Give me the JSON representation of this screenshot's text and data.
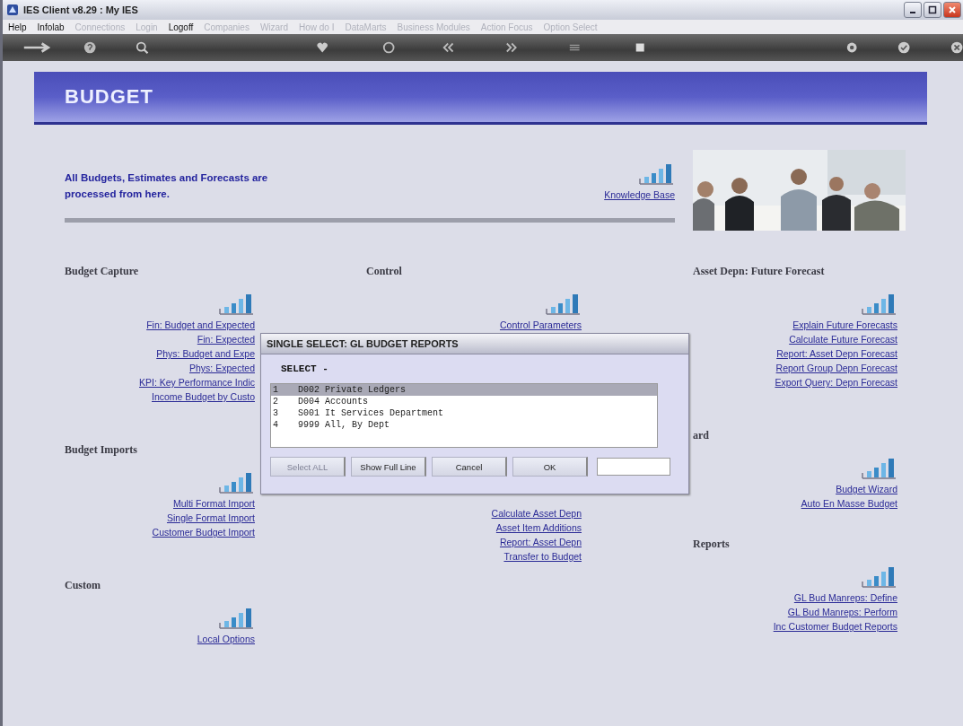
{
  "window": {
    "title": "IES Client v8.29 : My IES"
  },
  "menu": [
    {
      "label": "Help",
      "disabled": false
    },
    {
      "label": "Infolab",
      "disabled": false
    },
    {
      "label": "Connections",
      "disabled": true
    },
    {
      "label": "Login",
      "disabled": true
    },
    {
      "label": "Logoff",
      "disabled": false
    },
    {
      "label": "Companies",
      "disabled": true
    },
    {
      "label": "Wizard",
      "disabled": true
    },
    {
      "label": "How do I",
      "disabled": true
    },
    {
      "label": "DataMarts",
      "disabled": true
    },
    {
      "label": "Business Modules",
      "disabled": true
    },
    {
      "label": "Action Focus",
      "disabled": true
    },
    {
      "label": "Option Select",
      "disabled": true
    }
  ],
  "toolbar": [
    {
      "kind": "arrow"
    },
    {
      "kind": "help"
    },
    {
      "kind": "search"
    },
    {
      "kind": "heart"
    },
    {
      "kind": "circle"
    },
    {
      "kind": "rewind"
    },
    {
      "kind": "forward"
    },
    {
      "kind": "lines"
    },
    {
      "kind": "square"
    },
    {
      "kind": "gear"
    },
    {
      "kind": "check"
    },
    {
      "kind": "close"
    }
  ],
  "banner": {
    "title": "BUDGET"
  },
  "intro": {
    "text": "All Budgets, Estimates and Forecasts are processed from here.",
    "link": "Knowledge Base"
  },
  "columns": [
    {
      "sections": [
        {
          "heading": "Budget Capture",
          "links": [
            "Fin: Budget and Expected",
            "Fin: Expected",
            "Phys: Budget and Expe",
            "Phys: Expected",
            "KPI: Key Performance Indic",
            "Income Budget by Custo"
          ]
        },
        {
          "heading": "Budget Imports",
          "links": [
            "Multi Format Import",
            "Single Format Import",
            "Customer Budget Import"
          ]
        },
        {
          "heading": "Custom",
          "links": [
            "Local Options"
          ]
        }
      ]
    },
    {
      "sections": [
        {
          "heading": "Control",
          "links": [
            "Control Parameters"
          ]
        },
        {
          "links": [
            "Calculate Asset Depn",
            "Asset Item Additions",
            "Report: Asset Depn",
            "Transfer to Budget"
          ]
        }
      ]
    },
    {
      "sections": [
        {
          "heading": "Asset Depn: Future Forecast",
          "links": [
            "Explain Future Forecasts",
            "Calculate Future Forecast",
            "Report: Asset Depn Forecast",
            "Report Group Depn Forecast",
            "Export Query: Depn Forecast"
          ]
        },
        {
          "heading": "ard",
          "links": [
            "Budget Wizard",
            "Auto En Masse Budget"
          ]
        },
        {
          "heading": "Reports",
          "links": [
            "GL Bud Manreps: Define",
            "GL Bud Manreps: Perform",
            "Inc Customer Budget Reports"
          ]
        }
      ]
    }
  ],
  "dialog": {
    "title": "SINGLE SELECT: GL BUDGET REPORTS",
    "prompt": "SELECT -",
    "items": [
      {
        "number": "1",
        "text": "D002 Private Ledgers",
        "selected": true
      },
      {
        "number": "2",
        "text": "D004 Accounts",
        "selected": false
      },
      {
        "number": "3",
        "text": "S001 It Services Department",
        "selected": false
      },
      {
        "number": "4",
        "text": "9999 All, By Dept",
        "selected": false
      }
    ],
    "buttons": [
      {
        "label": "Select ALL",
        "disabled": true
      },
      {
        "label": "Show Full Line",
        "disabled": false
      },
      {
        "label": "Cancel",
        "disabled": false
      },
      {
        "label": "OK",
        "disabled": false
      }
    ]
  }
}
